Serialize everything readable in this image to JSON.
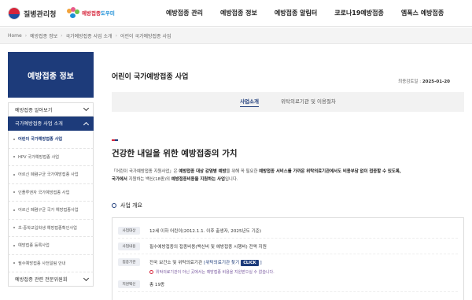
{
  "header": {
    "logo": "질병관리청",
    "sublogo": {
      "part1": "예방접종",
      "part2": "도우미"
    },
    "nav": [
      "예방접종 관리",
      "예방접종 정보",
      "예방접종 알림터",
      "코로나19예방접종",
      "엠폭스 예방접종"
    ]
  },
  "breadcrumb": [
    "Home",
    "예방접종 정보",
    "국가예방접종 사업 소개",
    "어린이 국가예방접종 사업"
  ],
  "sidebar": {
    "title": "예방접종 정보",
    "groups": [
      {
        "label": "예방접종 알아보기"
      },
      {
        "label": "국가예방접종 사업 소개"
      }
    ],
    "items": [
      "어린이 국가예방접종 사업",
      "HPV 국가예방접종 사업",
      "어르신 폐렴구균 국가예방접종 사업",
      "인플루엔자 국가예방접종 사업",
      "어르신 폐렴구균 국가 예방접종사업",
      "초·중학교입학생 예방접종확인사업",
      "예방접종 등록사업",
      "필수예방접종 사전알림 안내"
    ],
    "last_group": "예방접종 관련 전문위원회"
  },
  "main": {
    "page_title": "어린이 국가예방접종 사업",
    "date_label": "최종검토일",
    "date_value": "2025-01-20",
    "tabs": [
      "사업소개",
      "위탁의료기관 및 이용절차"
    ],
    "accent_colors": [
      "#d6243a",
      "#1d3b7a"
    ],
    "headline": "건강한 내일을 위한 예방접종의 가치",
    "desc": {
      "p1": "「어린이 국가예방접종 지원사업」은 ",
      "b1": "예방접종 대상 감염병 예방",
      "p2": "을 위해 꼭 필요한 ",
      "b2": "예방접종 서비스를 가까운 위탁의료기관에서도 비용부담 없이 접종할 수 있도록,",
      "b3": "국가에서",
      "p3": " 지원하는 백신(18종)의 ",
      "b4": "예방접종비용을 지원하는 사업",
      "p4": "입니다."
    },
    "overview_title": "사업 개요",
    "rows": [
      {
        "label": "사업대상",
        "value": "12세 이하 어린이(2012.1.1. 이후 출생자, 2025년도 기준)"
      },
      {
        "label": "사업내용",
        "value": "필수예방접종의 접종비용(백신비 및 예방접종 시행비) 전액 지원"
      },
      {
        "label": "접종기관",
        "value": "전국 보건소 및 위탁의료기관",
        "link": "[위탁의료기관 찾기",
        "click": "CLICK",
        "end": "]"
      },
      {
        "label": "지원백신",
        "value": "총 19종"
      }
    ],
    "note": "위탁의료기관이 아닌 곳에서는 예방접종 비용을 지원받으실 수 없습니다."
  }
}
